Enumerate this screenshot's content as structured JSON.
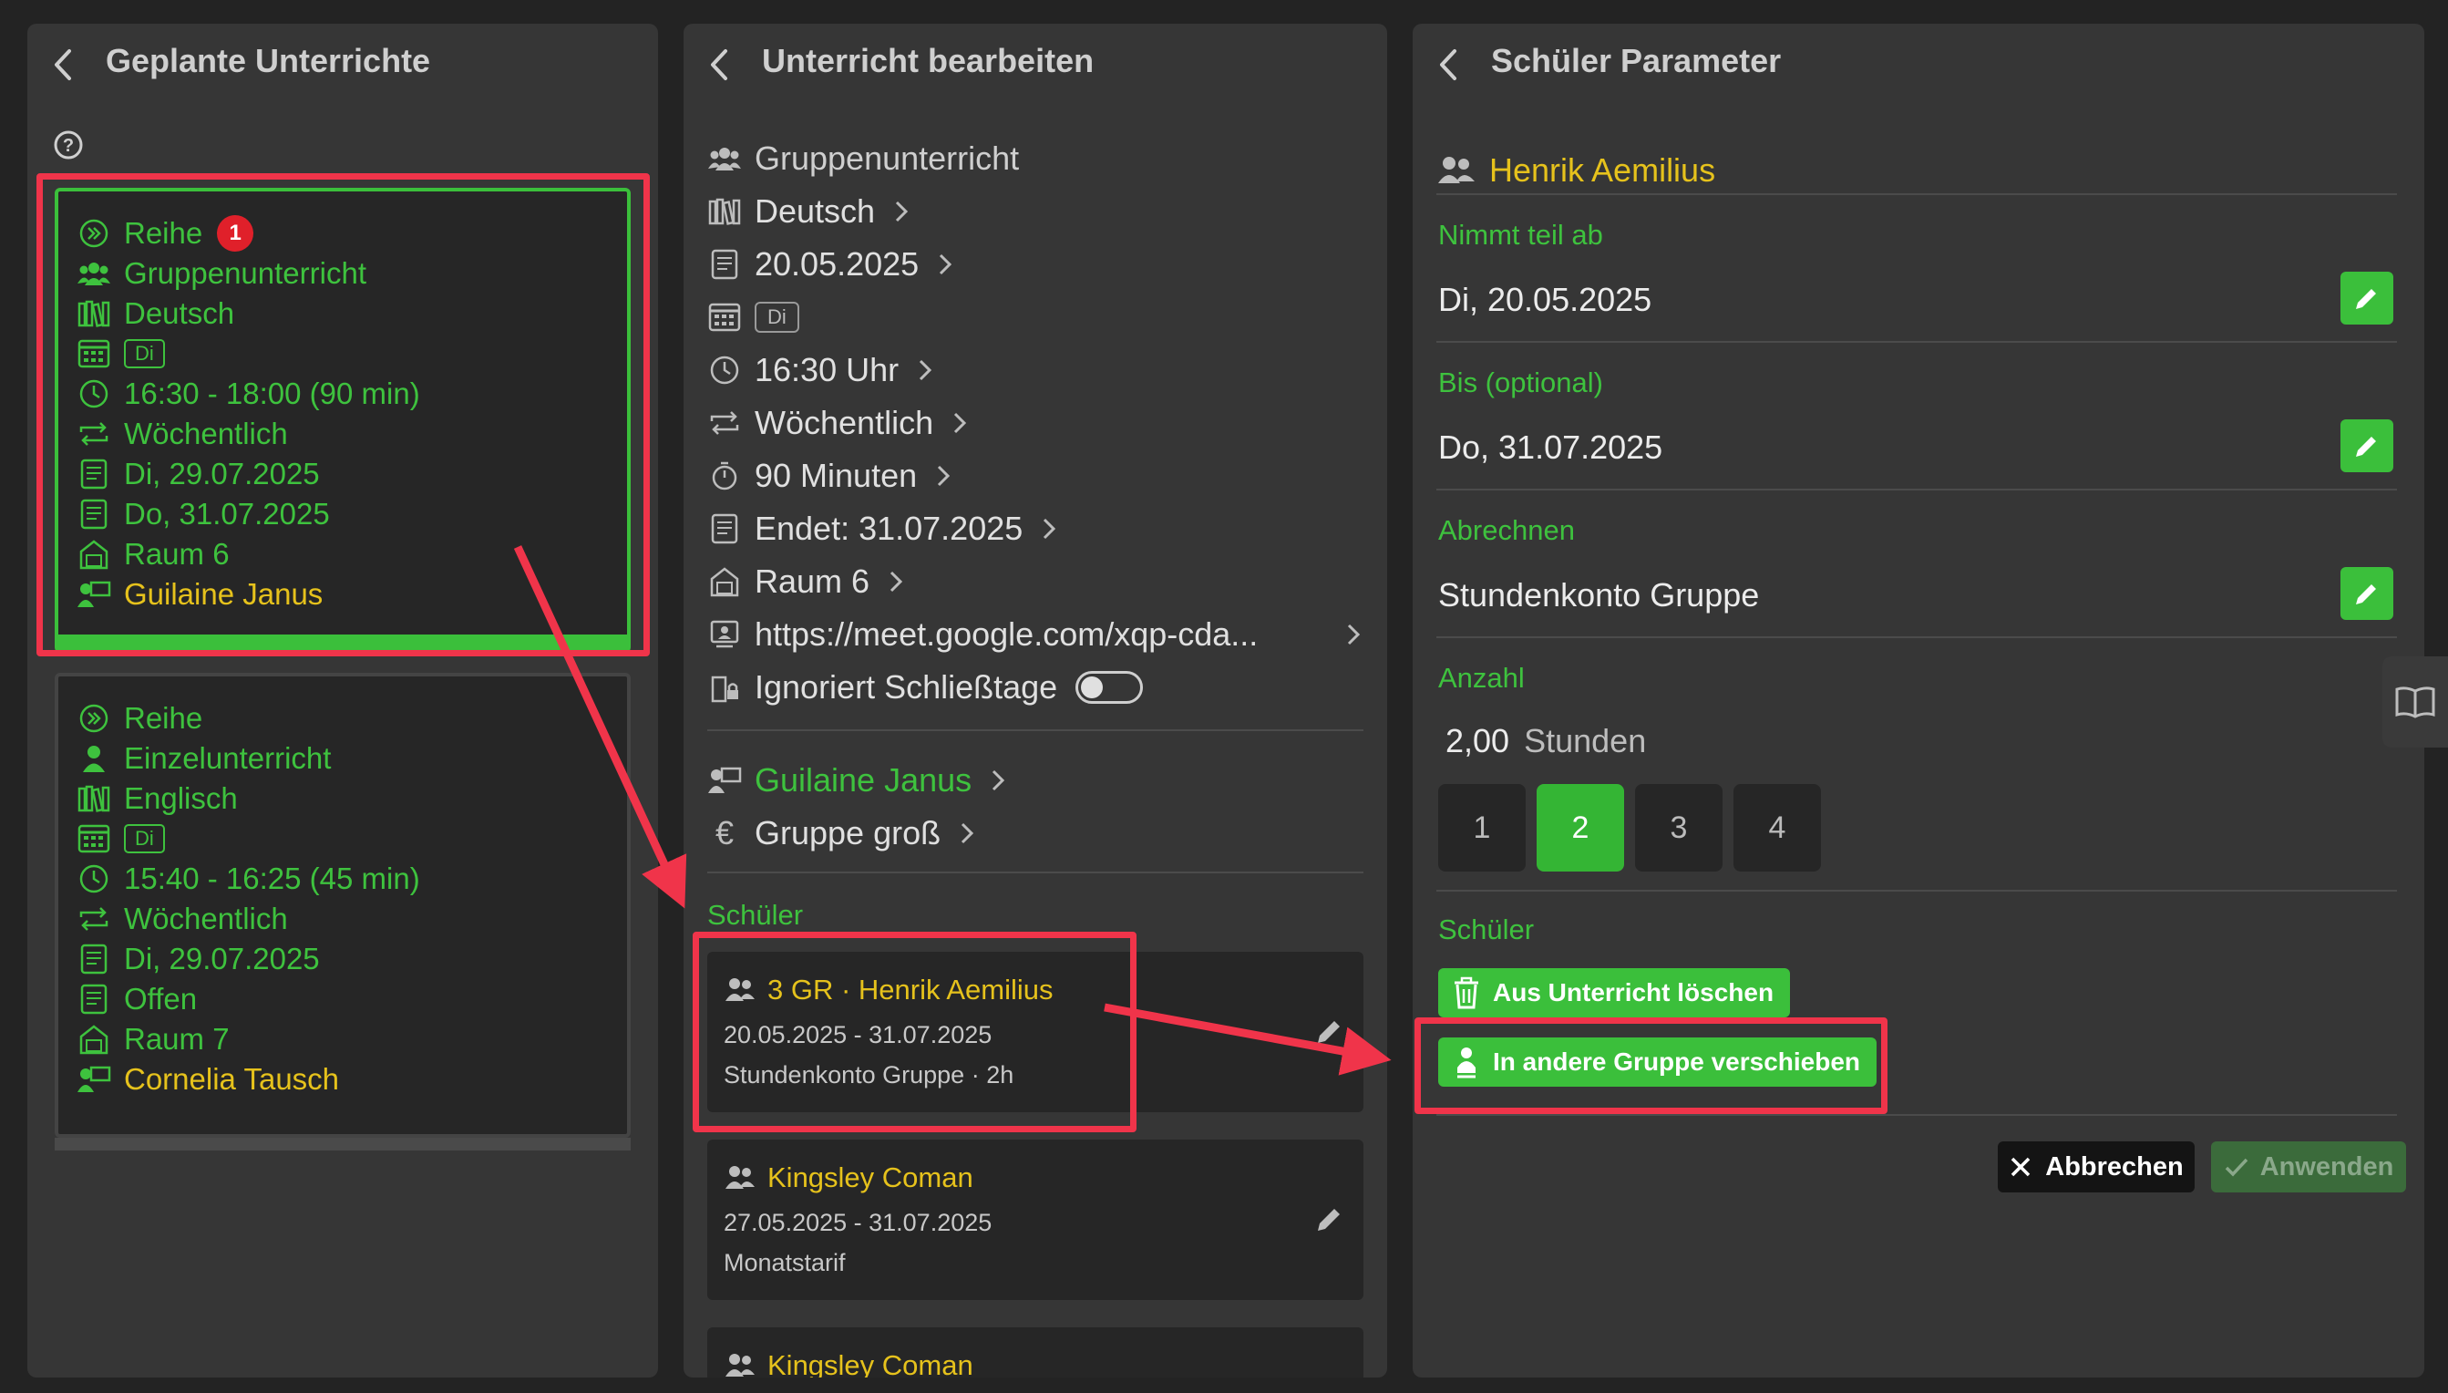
{
  "left_panel": {
    "title": "Geplante Unterrichte",
    "lessons": [
      {
        "series_label": "Reihe",
        "badge": "1",
        "type": "Gruppenunterricht",
        "subject": "Deutsch",
        "day_chip": "Di",
        "time": "16:30 - 18:00  (90 min)",
        "frequency": "Wöchentlich",
        "start_date": "Di, 29.07.2025",
        "end_date": "Do, 31.07.2025",
        "room": "Raum 6",
        "teacher": "Guilaine Janus"
      },
      {
        "series_label": "Reihe",
        "type": "Einzelunterricht",
        "subject": "Englisch",
        "day_chip": "Di",
        "time": "15:40 - 16:25  (45 min)",
        "frequency": "Wöchentlich",
        "start_date": "Di, 29.07.2025",
        "end_date": "Offen",
        "room": "Raum 7",
        "teacher": "Cornelia Tausch"
      }
    ]
  },
  "middle_panel": {
    "title": "Unterricht bearbeiten",
    "type": "Gruppenunterricht",
    "subject": "Deutsch",
    "date": "20.05.2025",
    "day_chip": "Di",
    "time": "16:30 Uhr",
    "frequency": "Wöchentlich",
    "duration": "90 Minuten",
    "ends": "Endet: 31.07.2025",
    "room": "Raum 6",
    "link": "https://meet.google.com/xqp-cda...",
    "ignore_closing_days": "Ignoriert Schließtage",
    "teacher": "Guilaine Janus",
    "tariff": "Gruppe groß",
    "students_label": "Schüler",
    "students": [
      {
        "name": "3 GR · Henrik Aemilius",
        "period": "20.05.2025 - 31.07.2025",
        "billing": "Stundenkonto Gruppe · 2h"
      },
      {
        "name": "Kingsley Coman",
        "period": "27.05.2025 - 31.07.2025",
        "billing": "Monatstarif"
      },
      {
        "name": "Kingsley Coman"
      }
    ]
  },
  "right_panel": {
    "title": "Schüler Parameter",
    "student_name": "Henrik Aemilius",
    "participates_from_label": "Nimmt teil ab",
    "participates_from": "Di, 20.05.2025",
    "until_label": "Bis (optional)",
    "until": "Do, 31.07.2025",
    "billing_label": "Abrechnen",
    "billing": "Stundenkonto Gruppe",
    "amount_label": "Anzahl",
    "amount_value": "2,00",
    "amount_unit": "Stunden",
    "amount_options": [
      "1",
      "2",
      "3",
      "4"
    ],
    "amount_selected": "2",
    "students_label": "Schüler",
    "remove_button": "Aus Unterricht löschen",
    "move_button": "In andere Gruppe verschieben",
    "cancel_button": "Abbrechen",
    "apply_button": "Anwenden"
  },
  "colors": {
    "accent_green": "#3ec23e",
    "name_yellow": "#e6c21c",
    "highlight_red": "#f0344a",
    "badge_red": "#e0202a"
  }
}
